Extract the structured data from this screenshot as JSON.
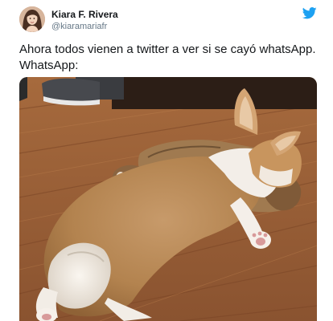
{
  "tweet": {
    "author_name": "Kiara F. Rivera",
    "author_handle": "@kiaramariafr",
    "text_line1": "Ahora todos vienen a twitter a ver si se cayó whatsApp.",
    "text_line2": "WhatsApp:",
    "brand_icon": "twitter-bird-icon",
    "brand_color": "#1da1f2",
    "media_description_icon": "corgi-puppy-photo"
  }
}
